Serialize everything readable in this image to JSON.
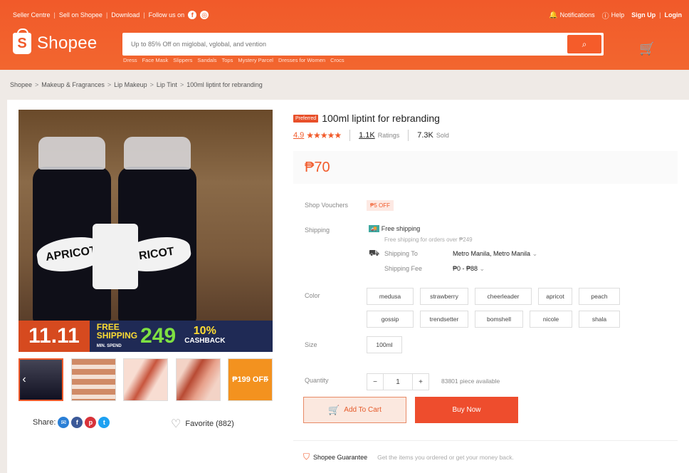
{
  "colors": {
    "brand": "#ee4d2d",
    "header": "#f15a2a",
    "price": "#f15a2a"
  },
  "topbar": {
    "left": [
      "Seller Centre",
      "Sell on Shopee",
      "Download",
      "Follow us on"
    ],
    "right": {
      "notifications": "Notifications",
      "help": "Help",
      "signup": "Sign Up",
      "login": "Login"
    }
  },
  "logo": {
    "text": "Shopee"
  },
  "search": {
    "placeholder": "Up to 85% Off on miglobal, vglobal, and vention",
    "suggestions": [
      "Dress",
      "Face Mask",
      "Slippers",
      "Sandals",
      "Tops",
      "Mystery Parcel",
      "Dresses for Women",
      "Crocs"
    ]
  },
  "breadcrumb": [
    "Shopee",
    "Makeup & Fragrances",
    "Lip Makeup",
    "Lip Tint",
    "100ml liptint for rebranding"
  ],
  "image": {
    "label_left": "APRICOT",
    "label_right": "RICOT",
    "promo_sale": "11.11",
    "promo_free": "FREE",
    "promo_shipping": "SHIPPING",
    "promo_min": "MIN. SPEND",
    "promo_amount": "249",
    "promo_cashback_pct": "10%",
    "promo_cashback": "CASHBACK"
  },
  "thumbs": {
    "last_text": "₱199 OFF"
  },
  "share": {
    "label": "Share:"
  },
  "favorite": {
    "label": "Favorite (882)"
  },
  "product": {
    "badge": "Preferred",
    "name": "100ml liptint for rebranding",
    "rating": "4.9",
    "ratings_count": "1.1K",
    "ratings_label": "Ratings",
    "sold_count": "7.3K",
    "sold_label": "Sold",
    "price": "₱70"
  },
  "details": {
    "vouchers_label": "Shop Vouchers",
    "voucher": "₱5 OFF",
    "shipping_label": "Shipping",
    "free_shipping": "Free shipping",
    "free_shipping_sub": "Free shipping for orders over ₱249",
    "ship_to_label": "Shipping To",
    "ship_to_value": "Metro Manila, Metro Manila",
    "fee_label": "Shipping Fee",
    "fee_value": "₱0 - ₱88",
    "color_label": "Color",
    "colors": [
      "medusa",
      "strawberry",
      "cheerleader",
      "apricot",
      "peach",
      "gossip",
      "trendsetter",
      "bomshell",
      "nicole",
      "shala"
    ],
    "size_label": "Size",
    "size": "100ml",
    "quantity_label": "Quantity",
    "quantity": "1",
    "available": "83801 piece available"
  },
  "actions": {
    "add_to_cart": "Add To Cart",
    "buy_now": "Buy Now"
  },
  "guarantee": {
    "title": "Shopee Guarantee",
    "desc": "Get the items you ordered or get your money back."
  }
}
